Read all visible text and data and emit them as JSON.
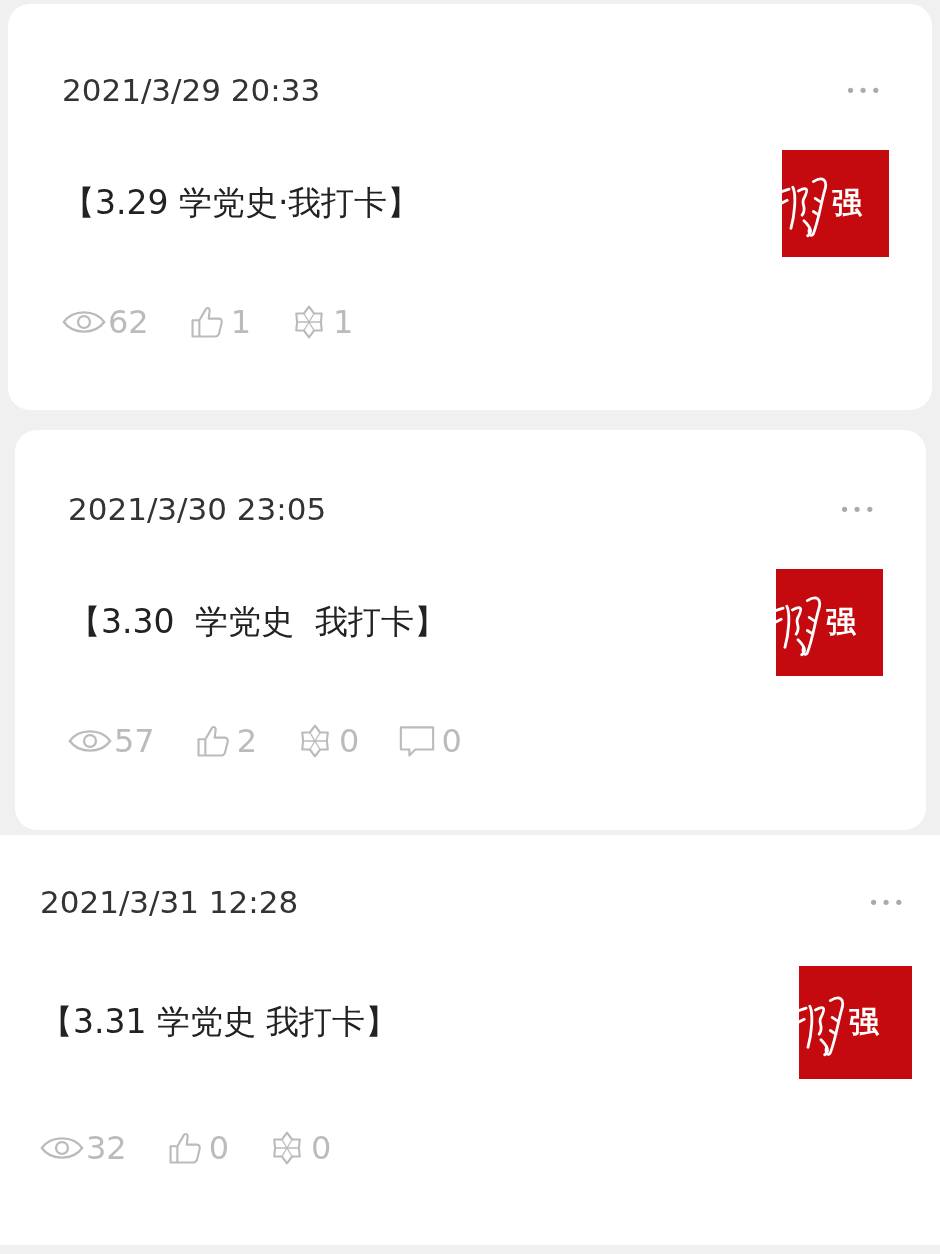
{
  "posts": [
    {
      "time": "2021/3/29 20:33",
      "more": "•••",
      "title": "【3.29 学党史·我打卡】",
      "thumbnail_text": "强",
      "stats": [
        {
          "kind": "view",
          "count": "62"
        },
        {
          "kind": "like",
          "count": "1"
        },
        {
          "kind": "star",
          "count": "1"
        }
      ]
    },
    {
      "time": "2021/3/30 23:05",
      "more": "•••",
      "title": "【3.30  学党史  我打卡】",
      "thumbnail_text": "强",
      "stats": [
        {
          "kind": "view",
          "count": "57"
        },
        {
          "kind": "like",
          "count": "2"
        },
        {
          "kind": "star",
          "count": "0"
        },
        {
          "kind": "comment",
          "count": "0"
        }
      ]
    },
    {
      "time": "2021/3/31 12:28",
      "more": "•••",
      "title": "【3.31 学党史 我打卡】",
      "thumbnail_text": "强",
      "stats": [
        {
          "kind": "view",
          "count": "32"
        },
        {
          "kind": "like",
          "count": "0"
        },
        {
          "kind": "star",
          "count": "0"
        }
      ]
    }
  ]
}
